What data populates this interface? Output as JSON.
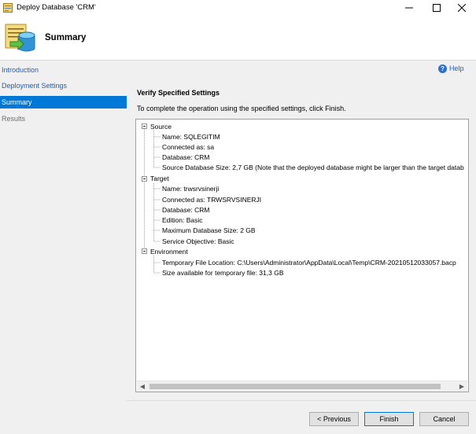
{
  "window": {
    "title": "Deploy Database 'CRM'",
    "controls": {
      "minimize": "minimize-icon",
      "maximize": "maximize-icon",
      "close": "close-icon"
    }
  },
  "banner": {
    "title": "Summary",
    "icon": "database-deploy-icon"
  },
  "nav": {
    "items": [
      {
        "label": "Introduction",
        "state": "link"
      },
      {
        "label": "Deployment Settings",
        "state": "link"
      },
      {
        "label": "Summary",
        "state": "selected"
      },
      {
        "label": "Results",
        "state": "disabled"
      }
    ]
  },
  "help": {
    "label": "Help",
    "icon": "help-icon"
  },
  "content": {
    "heading": "Verify Specified Settings",
    "instruction": "To complete the operation using the specified settings, click Finish."
  },
  "tree": {
    "source": {
      "label": "Source",
      "items": [
        "Name: SQLEGITIM",
        "Connected as: sa",
        "Database: CRM",
        "Source Database Size: 2,7 GB (Note that the deployed database might be larger than the target datab"
      ]
    },
    "target": {
      "label": "Target",
      "items": [
        "Name: trwsrvsinerji",
        "Connected as: TRWSRVSINERJI",
        "Database: CRM",
        "Edition: Basic",
        "Maximum Database Size: 2 GB",
        "Service Objective: Basic"
      ]
    },
    "environment": {
      "label": "Environment",
      "items": [
        "Temporary File Location: C:\\Users\\Administrator\\AppData\\Local\\Temp\\CRM-20210512033057.bacp",
        "Size available for temporary file: 31,3 GB"
      ]
    }
  },
  "buttons": {
    "previous": "< Previous",
    "finish": "Finish",
    "cancel": "Cancel"
  },
  "colors": {
    "accent": "#0078d7",
    "link": "#1f5fbf",
    "sidebar_bg": "#f0f0f0"
  }
}
